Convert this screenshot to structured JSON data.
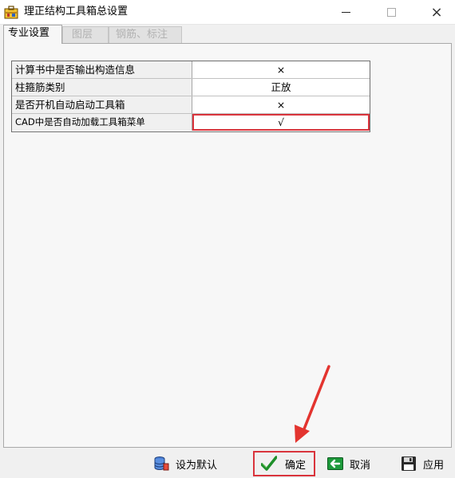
{
  "window": {
    "title": "理正结构工具箱总设置",
    "icon": "toolbox-app-icon",
    "controls": {
      "close_glyph": "×"
    }
  },
  "tabs": [
    {
      "label": "专业设置",
      "active": true
    },
    {
      "label": "图层",
      "active": false
    },
    {
      "label": "钢筋、标注",
      "active": false
    }
  ],
  "settings": [
    {
      "label": "计算书中是否输出构造信息",
      "value": "×"
    },
    {
      "label": "柱箍筋类别",
      "value": "正放"
    },
    {
      "label": "是否开机自动启动工具箱",
      "value": "×"
    },
    {
      "label": "CAD中是否自动加载工具箱菜单",
      "value": "√",
      "selected": true
    }
  ],
  "buttons": {
    "set_default": "设为默认",
    "ok": "确定",
    "cancel": "取消",
    "apply": "应用"
  },
  "colors": {
    "highlight": "#d9343c",
    "ok_check": "#1e8f2a",
    "cancel_arrow": "#1d9a3b"
  }
}
